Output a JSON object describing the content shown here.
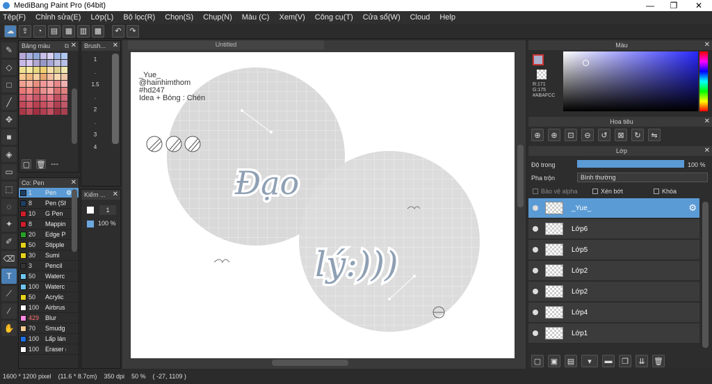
{
  "window": {
    "title": "MediBang Paint Pro (64bit)",
    "minimize": "—",
    "maximize": "❐",
    "close": "✕"
  },
  "menu": [
    "Tệp(F)",
    "Chỉnh sửa(E)",
    "Lớp(L)",
    "Bộ lọc(R)",
    "Chọn(S)",
    "Chụp(N)",
    "Màu (C)",
    "Xem(V)",
    "Công cụ(T)",
    "Cửa sổ(W)",
    "Cloud",
    "Help"
  ],
  "palette_panel": {
    "title": "Bảng màu",
    "footer": "---"
  },
  "brush_panel": {
    "title": "Brush...",
    "sizes": [
      "1",
      ".",
      "1.5",
      ".",
      "2",
      ".",
      "3",
      "4"
    ]
  },
  "brushes_panel": {
    "title": "Co: Pen",
    "items": [
      {
        "size": "1",
        "name": "Pen",
        "color": "#1f3e63"
      },
      {
        "size": "8",
        "name": "Pen (Sh",
        "color": "#1f3e63"
      },
      {
        "size": "10",
        "name": "G Pen",
        "color": "#d01d2a"
      },
      {
        "size": "8",
        "name": "Mappin",
        "color": "#d01d2a"
      },
      {
        "size": "20",
        "name": "Edge P",
        "color": "#28a028"
      },
      {
        "size": "50",
        "name": "Stipple",
        "color": "#e6d21a"
      },
      {
        "size": "30",
        "name": "Sumi",
        "color": "#e6d21a"
      },
      {
        "size": "3",
        "name": "Pencil",
        "color": "#333333"
      },
      {
        "size": "50",
        "name": "Waterc",
        "color": "#6ec6f0"
      },
      {
        "size": "100",
        "name": "Waterc",
        "color": "#6ec6f0"
      },
      {
        "size": "50",
        "name": "Acrylic",
        "color": "#e6d21a"
      },
      {
        "size": "100",
        "name": "Airbrus",
        "color": "#ffffff"
      },
      {
        "size": "429",
        "name": "Blur",
        "color": "#ff88e0"
      },
      {
        "size": "70",
        "name": "Smudg",
        "color": "#f0c890"
      },
      {
        "size": "100",
        "name": "Lấp lán",
        "color": "#1e6fe0"
      },
      {
        "size": "100",
        "name": "Eraser (",
        "color": "#ffffff"
      }
    ]
  },
  "kiem_panel": {
    "title": "Kiếm ...",
    "value": "1",
    "opacity": "100 %"
  },
  "canvas": {
    "tab_title": "Untitled",
    "credit_lines": [
      "_Yue_",
      "@hainhimthom",
      "#hd247",
      "Idea + Bóng : Chén"
    ],
    "word1": "Đạo",
    "word2": "lý:)))"
  },
  "color_panel": {
    "title": "Màu",
    "r": "R:171",
    "g": "G:175",
    "hex": "#ABAFCC",
    "accent": "#ABAFCC"
  },
  "navigator_panel": {
    "title": "Hoa tiêu"
  },
  "layer_panel": {
    "title": "Lớp",
    "opacity_label": "Độ trong",
    "opacity_value": "100 %",
    "opacity_fraction": 1.0,
    "blend_label": "Pha trộn",
    "blend_value": "Bình thường",
    "protect_alpha": "Bảo vệ alpha",
    "clipping": "Xén bớt",
    "lock": "Khóa",
    "layers": [
      {
        "name": "_Yue_",
        "selected": true
      },
      {
        "name": "Lớp6",
        "selected": false
      },
      {
        "name": "Lớp5",
        "selected": false
      },
      {
        "name": "Lớp2",
        "selected": false
      },
      {
        "name": "Lớp2",
        "selected": false
      },
      {
        "name": "Lớp4",
        "selected": false
      },
      {
        "name": "Lớp1",
        "selected": false
      }
    ]
  },
  "status": {
    "size": "1600 * 1200 pixel",
    "cm": "(11.6 * 8.7cm)",
    "dpi": "350 dpi",
    "zoom": "50 %",
    "coords": "( -27, 1109 )"
  }
}
